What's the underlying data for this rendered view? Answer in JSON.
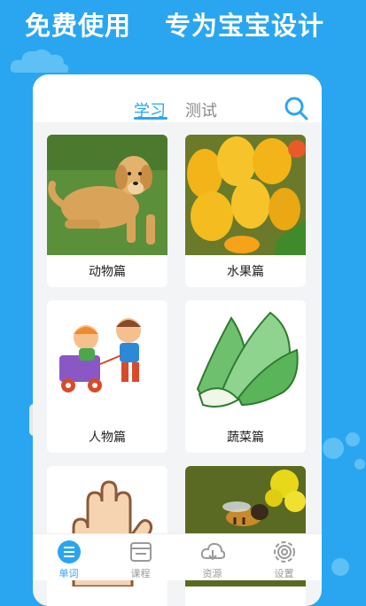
{
  "banner": {
    "left_text": "免费使用",
    "right_text": "专为宝宝设计"
  },
  "tabs": {
    "learn": "学习",
    "test": "测试"
  },
  "cards": [
    {
      "label": "动物篇",
      "image": "golden-retriever-dog"
    },
    {
      "label": "水果篇",
      "image": "mangoes"
    },
    {
      "label": "人物篇",
      "image": "kids-cartoon"
    },
    {
      "label": "蔬菜篇",
      "image": "bok-choy-cartoon"
    },
    {
      "label": "",
      "image": "hand"
    },
    {
      "label": "",
      "image": "bee-on-flower"
    }
  ],
  "bottom_nav": [
    {
      "label": "单词",
      "icon": "list-icon",
      "active": true
    },
    {
      "label": "课程",
      "icon": "course-icon",
      "active": false
    },
    {
      "label": "资源",
      "icon": "cloud-icon",
      "active": false
    },
    {
      "label": "设置",
      "icon": "gear-icon",
      "active": false
    }
  ],
  "colors": {
    "accent": "#2aa6f0",
    "background": "#2aa6f0",
    "card_bg": "#ffffff"
  }
}
